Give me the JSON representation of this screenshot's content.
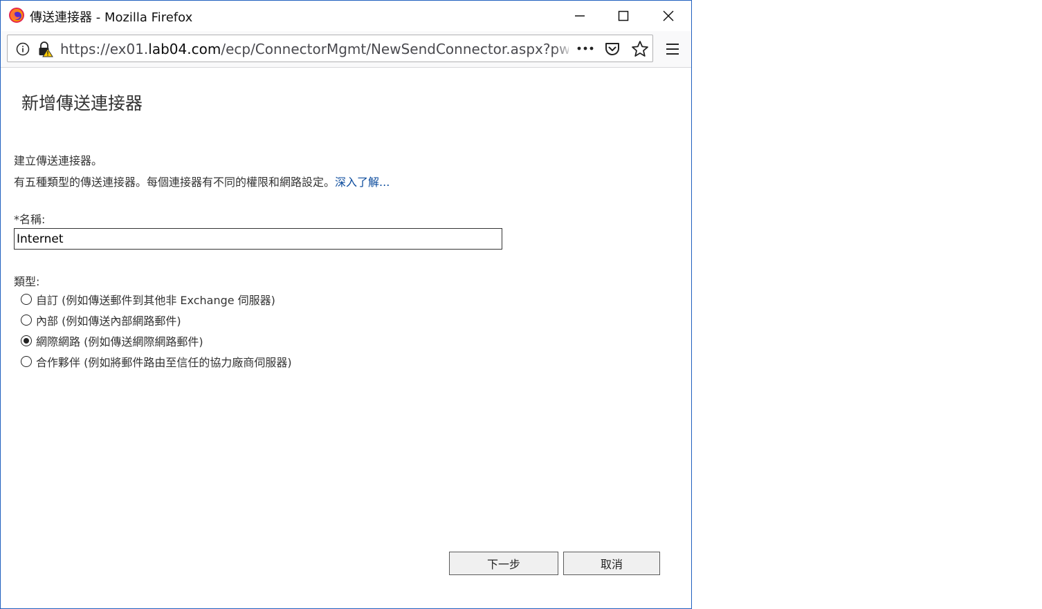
{
  "window": {
    "title": "傳送連接器 - Mozilla Firefox",
    "controls": {
      "minimize": "minimize-icon",
      "maximize": "maximize-icon",
      "close": "close-icon"
    }
  },
  "navbar": {
    "url_prefix": "https://ex01.",
    "url_host": "lab04.com",
    "url_path": "/ecp/ConnectorMgmt/NewSendConnector.aspx?pwmci",
    "icons": [
      "info-icon",
      "insecure-lock-icon",
      "page-actions-icon",
      "pocket-icon",
      "bookmark-star-icon",
      "hamburger-menu-icon"
    ]
  },
  "page": {
    "title": "新增傳送連接器",
    "description_line1": "建立傳送連接器。",
    "description_line2": "有五種類型的傳送連接器。每個連接器有不同的權限和網路設定。",
    "learn_more": "深入了解...",
    "name_label": "*名稱:",
    "name_value": "Internet",
    "type_label": "類型:",
    "type_options": [
      {
        "label": "自訂 (例如傳送郵件到其他非 Exchange 伺服器)",
        "selected": false
      },
      {
        "label": "內部 (例如傳送內部網路郵件)",
        "selected": false
      },
      {
        "label": "網際網路 (例如傳送網際網路郵件)",
        "selected": true
      },
      {
        "label": "合作夥伴 (例如將郵件路由至信任的協力廠商伺服器)",
        "selected": false
      }
    ]
  },
  "footer": {
    "next_label": "下一步",
    "cancel_label": "取消"
  },
  "colors": {
    "window_border": "#1f5fbf",
    "link": "#0a4a9c",
    "firefox_orange": "#ff9400"
  }
}
